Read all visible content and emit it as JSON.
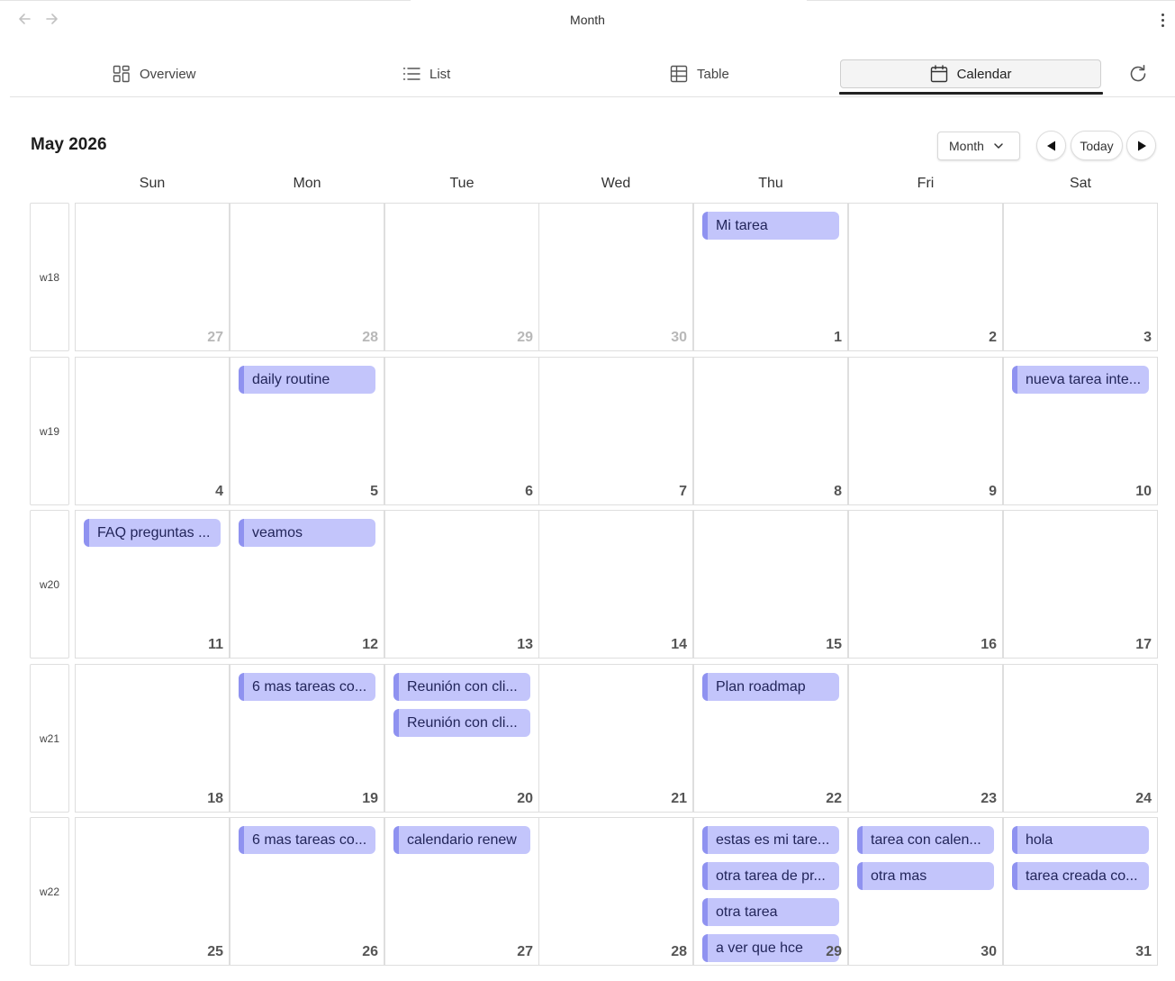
{
  "window": {
    "title": "Month"
  },
  "icons": {
    "back": "arrow-left-icon",
    "forward": "arrow-right-icon",
    "more": "more-vertical-icon",
    "refresh": "refresh-icon"
  },
  "tabs": [
    {
      "label": "Overview",
      "icon": "grid-icon",
      "active": false
    },
    {
      "label": "List",
      "icon": "list-icon",
      "active": false
    },
    {
      "label": "Table",
      "icon": "table-icon",
      "active": false
    },
    {
      "label": "Calendar",
      "icon": "calendar-icon",
      "active": true
    }
  ],
  "header": {
    "title": "May 2026",
    "view_select": "Month",
    "today_label": "Today"
  },
  "colors": {
    "event_bg": "#c3c5fb",
    "event_accent": "#8f92f0",
    "grid_border": "#dedede"
  },
  "weekdays": [
    "Sun",
    "Mon",
    "Tue",
    "Wed",
    "Thu",
    "Fri",
    "Sat"
  ],
  "weeks": [
    {
      "label": "w18",
      "days": [
        {
          "num": "27",
          "other": true,
          "events": []
        },
        {
          "num": "28",
          "other": true,
          "events": []
        },
        {
          "num": "29",
          "other": true,
          "events": []
        },
        {
          "num": "30",
          "other": true,
          "events": []
        },
        {
          "num": "1",
          "other": false,
          "events": [
            "Mi tarea"
          ]
        },
        {
          "num": "2",
          "other": false,
          "events": []
        },
        {
          "num": "3",
          "other": false,
          "events": []
        }
      ]
    },
    {
      "label": "w19",
      "days": [
        {
          "num": "4",
          "other": false,
          "events": []
        },
        {
          "num": "5",
          "other": false,
          "events": [
            "daily routine"
          ]
        },
        {
          "num": "6",
          "other": false,
          "events": []
        },
        {
          "num": "7",
          "other": false,
          "events": []
        },
        {
          "num": "8",
          "other": false,
          "events": []
        },
        {
          "num": "9",
          "other": false,
          "events": []
        },
        {
          "num": "10",
          "other": false,
          "events": [
            "nueva tarea inte..."
          ]
        }
      ]
    },
    {
      "label": "w20",
      "days": [
        {
          "num": "11",
          "other": false,
          "events": [
            "FAQ preguntas ..."
          ]
        },
        {
          "num": "12",
          "other": false,
          "events": [
            "veamos"
          ]
        },
        {
          "num": "13",
          "other": false,
          "events": []
        },
        {
          "num": "14",
          "other": false,
          "events": []
        },
        {
          "num": "15",
          "other": false,
          "events": []
        },
        {
          "num": "16",
          "other": false,
          "events": []
        },
        {
          "num": "17",
          "other": false,
          "events": []
        }
      ]
    },
    {
      "label": "w21",
      "days": [
        {
          "num": "18",
          "other": false,
          "events": []
        },
        {
          "num": "19",
          "other": false,
          "events": [
            "6 mas tareas co..."
          ]
        },
        {
          "num": "20",
          "other": false,
          "events": [
            "Reunión con cli...",
            "Reunión con cli..."
          ]
        },
        {
          "num": "21",
          "other": false,
          "events": []
        },
        {
          "num": "22",
          "other": false,
          "events": [
            "Plan roadmap"
          ]
        },
        {
          "num": "23",
          "other": false,
          "events": []
        },
        {
          "num": "24",
          "other": false,
          "events": []
        }
      ]
    },
    {
      "label": "w22",
      "days": [
        {
          "num": "25",
          "other": false,
          "events": []
        },
        {
          "num": "26",
          "other": false,
          "events": [
            "6 mas tareas co..."
          ]
        },
        {
          "num": "27",
          "other": false,
          "events": [
            "calendario renew"
          ]
        },
        {
          "num": "28",
          "other": false,
          "events": []
        },
        {
          "num": "29",
          "other": false,
          "events": [
            "estas es mi tare...",
            "otra tarea de pr...",
            "otra tarea",
            "a ver que hce"
          ]
        },
        {
          "num": "30",
          "other": false,
          "events": [
            "tarea con calen...",
            "otra mas"
          ]
        },
        {
          "num": "31",
          "other": false,
          "events": [
            "hola",
            "tarea creada co..."
          ]
        }
      ]
    }
  ]
}
